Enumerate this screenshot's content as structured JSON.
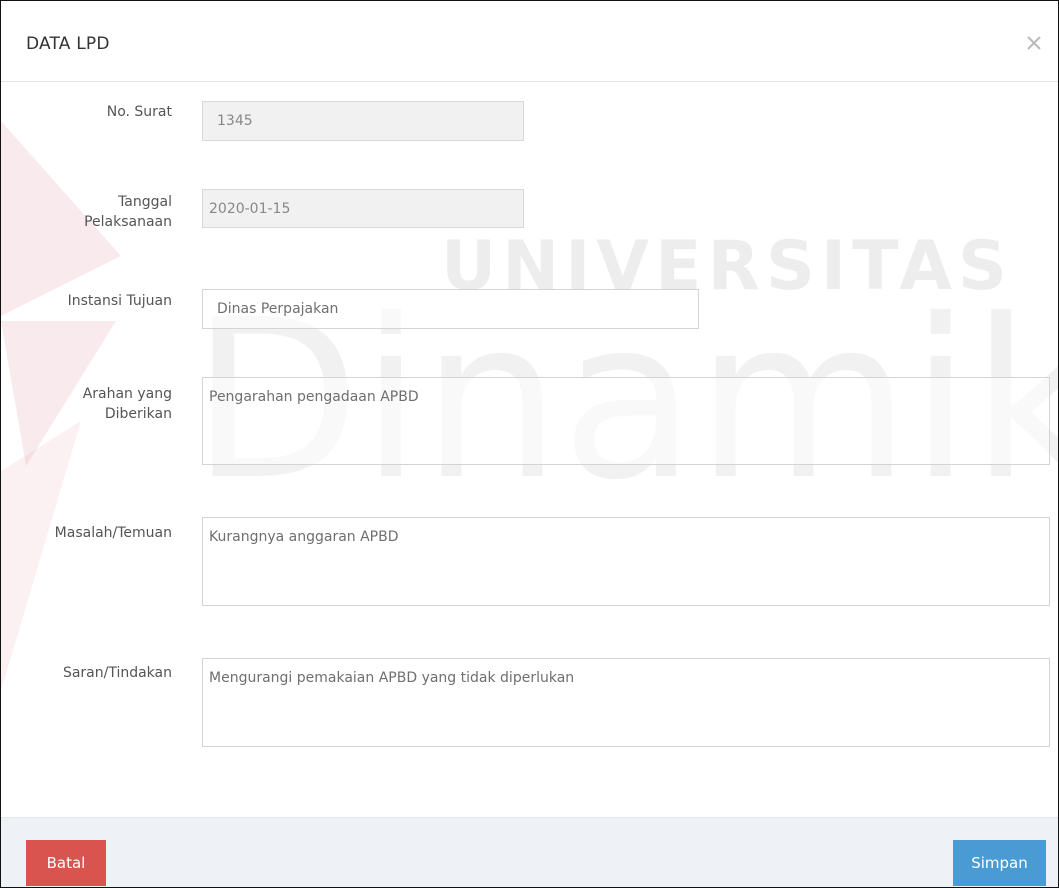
{
  "modal": {
    "title": "DATA LPD",
    "close_icon": "close-icon"
  },
  "watermark": {
    "line1": "UNIVERSITAS",
    "line2": "Dinamika"
  },
  "form": {
    "no_surat": {
      "label": "No. Surat",
      "value": "1345",
      "readonly": true
    },
    "tanggal_pelaksanaan": {
      "label_line1": "Tanggal",
      "label_line2": "Pelaksanaan",
      "value": "2020-01-15",
      "readonly": true
    },
    "instansi_tujuan": {
      "label": "Instansi Tujuan",
      "value": "Dinas Perpajakan"
    },
    "arahan": {
      "label_line1": "Arahan yang",
      "label_line2": "Diberikan",
      "value": "Pengarahan pengadaan APBD"
    },
    "masalah": {
      "label": "Masalah/Temuan",
      "value": "Kurangnya anggaran APBD"
    },
    "saran": {
      "label": "Saran/Tindakan",
      "value": "Mengurangi pemakaian APBD yang tidak diperlukan"
    }
  },
  "footer": {
    "cancel_label": "Batal",
    "save_label": "Simpan"
  },
  "colors": {
    "cancel": "#d9534f",
    "save": "#4a9ad4",
    "footer_bg": "#eef1f6"
  }
}
